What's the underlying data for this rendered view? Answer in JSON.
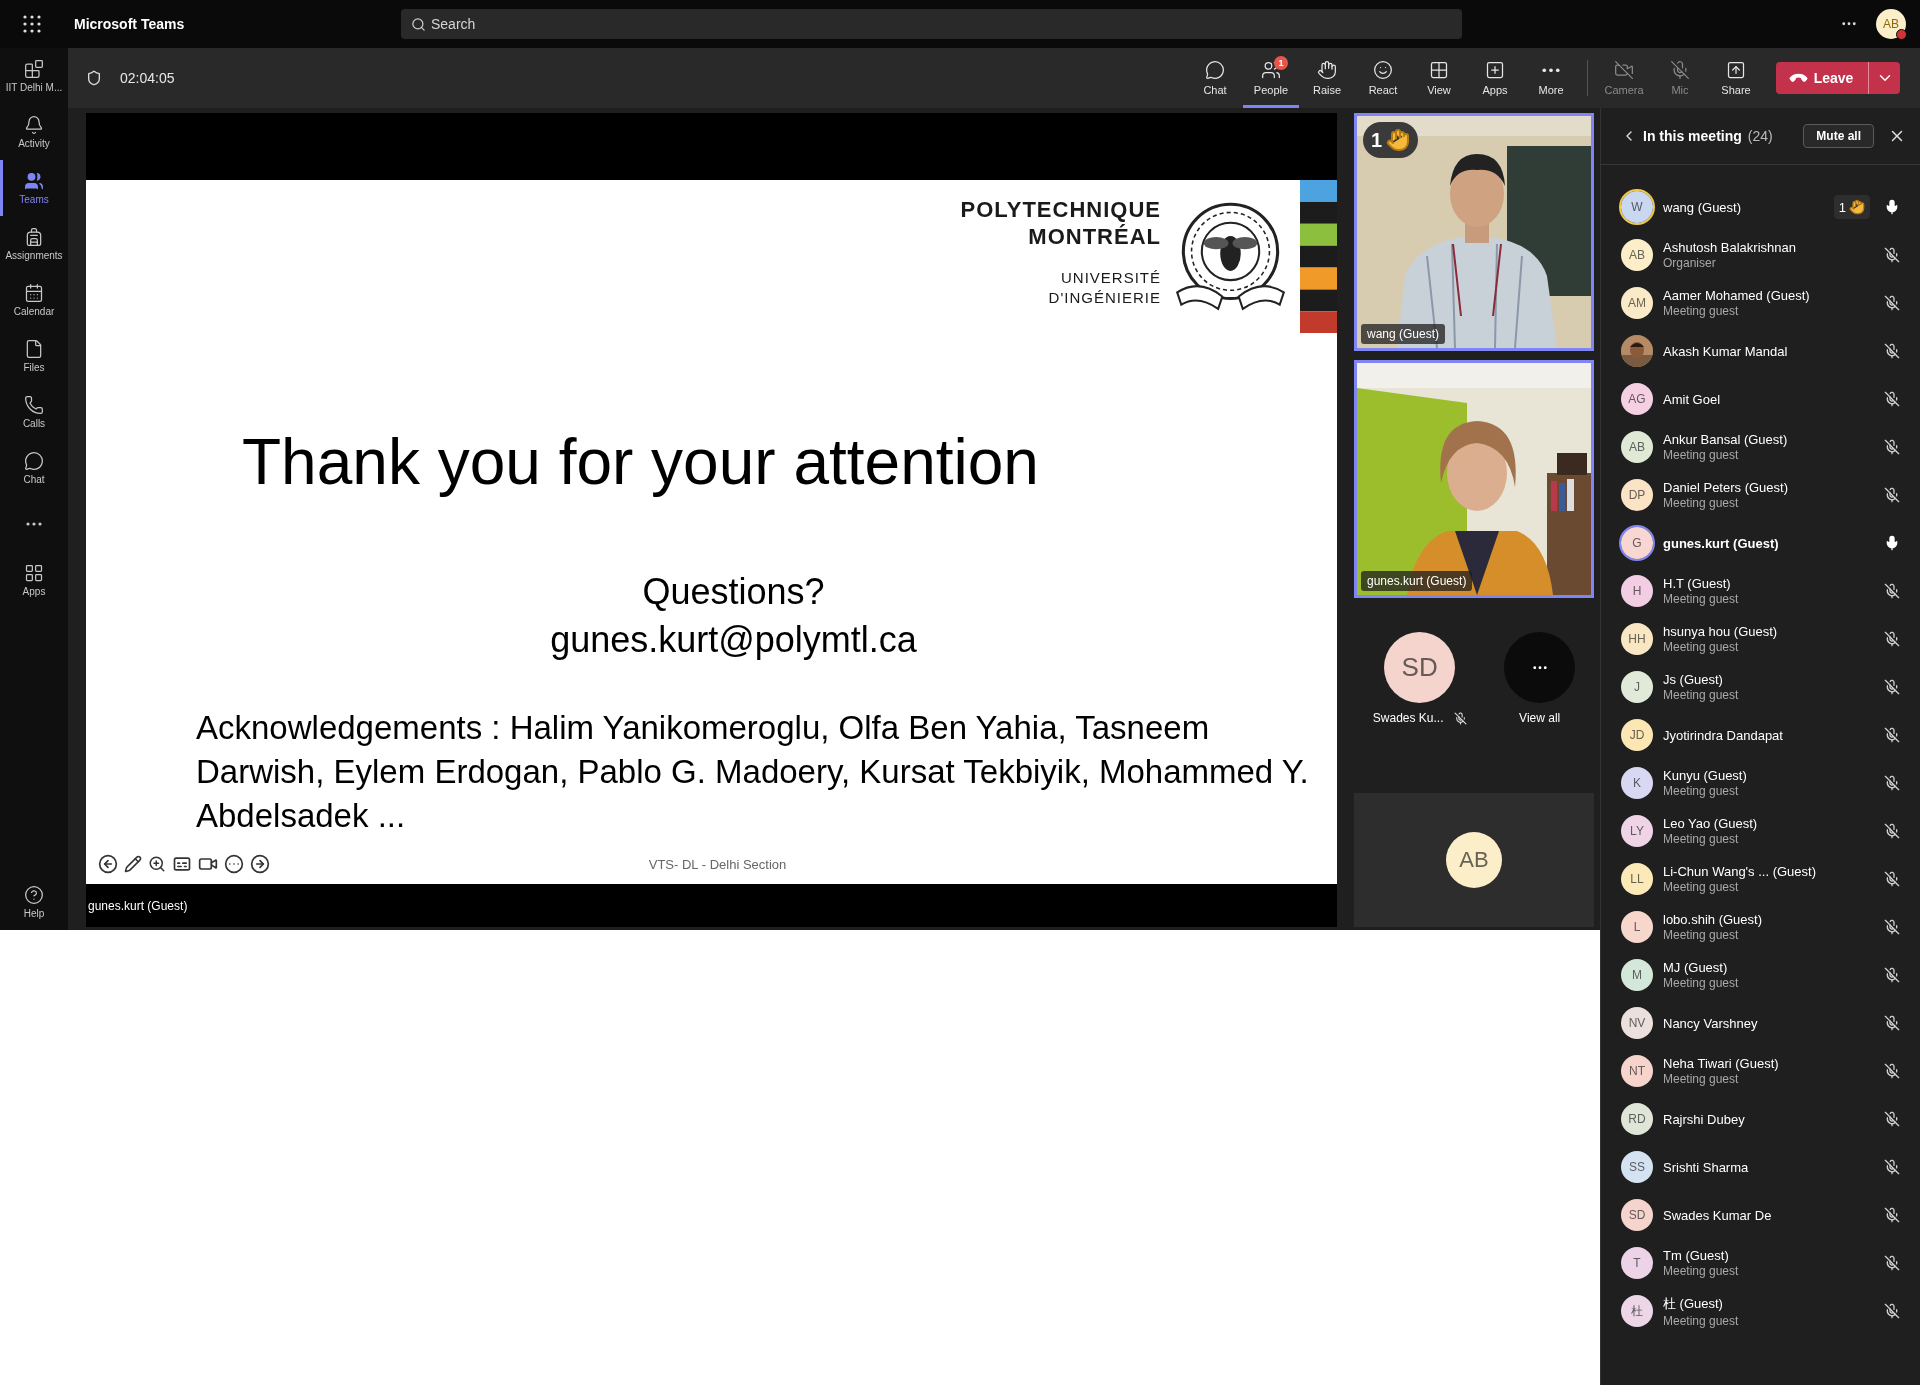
{
  "app": {
    "title": "Microsoft Teams"
  },
  "search": {
    "placeholder": "Search"
  },
  "account": {
    "initials": "AB"
  },
  "rail": {
    "items": [
      {
        "kind": "app",
        "label": "IIT Delhi M...",
        "selected": false
      },
      {
        "kind": "app",
        "label": "Activity",
        "selected": false
      },
      {
        "kind": "app",
        "label": "Teams",
        "selected": true
      },
      {
        "kind": "app",
        "label": "Assignments",
        "selected": false
      },
      {
        "kind": "app",
        "label": "Calendar",
        "selected": false
      },
      {
        "kind": "app",
        "label": "Files",
        "selected": false
      },
      {
        "kind": "app",
        "label": "Calls",
        "selected": false
      },
      {
        "kind": "app",
        "label": "Chat",
        "selected": false
      },
      {
        "kind": "more",
        "selected": false
      },
      {
        "kind": "app",
        "label": "Apps",
        "selected": false
      }
    ],
    "help": {
      "label": "Help"
    }
  },
  "meeting_toolbar": {
    "timer": "02:04:05",
    "actions": [
      {
        "label": "Chat",
        "selected": false
      },
      {
        "label": "People",
        "selected": true,
        "badge": "1"
      },
      {
        "label": "Raise",
        "selected": false
      },
      {
        "label": "React",
        "selected": false
      },
      {
        "label": "View",
        "selected": false
      },
      {
        "label": "Apps",
        "selected": false
      },
      {
        "label": "More",
        "selected": false
      }
    ],
    "devices": [
      {
        "label": "Camera",
        "off": true
      },
      {
        "label": "Mic",
        "off": true
      },
      {
        "label": "Share",
        "off": false
      }
    ],
    "leave": {
      "label": "Leave"
    }
  },
  "shared_content": {
    "slide": {
      "logo_lines": [
        "POLYTECHNIQUE",
        "MONTRÉAL"
      ],
      "logo_sub": [
        "UNIVERSITÉ",
        "D'INGÉNIERIE"
      ],
      "title": "Thank you for your attention",
      "questions": "Questions?",
      "email": "gunes.kurt@polymtl.ca",
      "acknowledgements": "Acknowledgements : Halim Yanikomeroglu, Olfa Ben Yahia, Tasneem Darwish, Eylem Erdogan, Pablo G. Madoery,  Kursat Tekbiyik, Mohammed Y. Abdelsadek  ...",
      "footer": "VTS- DL - Delhi Section"
    },
    "presenter": "gunes.kurt (Guest)"
  },
  "videos": [
    {
      "kind": "picture",
      "name": "wang (Guest)",
      "raised_hand": "1"
    },
    {
      "kind": "picture",
      "name": "gunes.kurt (Guest)"
    }
  ],
  "others": [
    {
      "kind": "avatar",
      "initials": "SD",
      "name": "Swades Ku...",
      "muted": true,
      "color": "#f4d4cc"
    },
    {
      "kind": "more",
      "label": "View all"
    }
  ],
  "self_view": {
    "initials": "AB",
    "color": "#fbeec8"
  },
  "panel": {
    "title": "In this meeting",
    "count": "(24)",
    "mute_all": "Mute all",
    "participants": [
      {
        "kind": "initials",
        "initials": "W",
        "name": "wang (Guest)",
        "color": "#c9d7f0",
        "muted": false,
        "speaking": false,
        "raised_hand": "1"
      },
      {
        "kind": "initials",
        "initials": "AB",
        "name": "Ashutosh Balakrishnan",
        "role": "Organiser",
        "color": "#fbeec8",
        "muted": true,
        "speaking": false
      },
      {
        "kind": "initials",
        "initials": "AM",
        "name": "Aamer Mohamed (Guest)",
        "role": "Meeting guest",
        "color": "#fbeac8",
        "muted": true,
        "speaking": false
      },
      {
        "name": "Akash Kumar Mandal",
        "muted": true,
        "speaking": false
      },
      {
        "kind": "initials",
        "initials": "AG",
        "name": "Amit Goel",
        "color": "#f5d0e2",
        "muted": true,
        "speaking": false
      },
      {
        "kind": "initials",
        "initials": "AB",
        "name": "Ankur Bansal (Guest)",
        "role": "Meeting guest",
        "color": "#dfe9d6",
        "muted": true,
        "speaking": false
      },
      {
        "kind": "initials",
        "initials": "DP",
        "name": "Daniel Peters (Guest)",
        "role": "Meeting guest",
        "color": "#fbe3c6",
        "muted": true,
        "speaking": false
      },
      {
        "kind": "initials",
        "initials": "G",
        "name": "gunes.kurt (Guest)",
        "color": "#f8d7d2",
        "muted": false,
        "speaking": true
      },
      {
        "kind": "initials",
        "initials": "H",
        "name": "H.T (Guest)",
        "role": "Meeting guest",
        "color": "#f3cde3",
        "muted": true,
        "speaking": false
      },
      {
        "kind": "initials",
        "initials": "HH",
        "name": "hsunya hou (Guest)",
        "role": "Meeting guest",
        "color": "#f9e6c2",
        "muted": true,
        "speaking": false
      },
      {
        "kind": "initials",
        "initials": "J",
        "name": "Js (Guest)",
        "role": "Meeting guest",
        "color": "#e1ead9",
        "muted": true,
        "speaking": false
      },
      {
        "kind": "initials",
        "initials": "JD",
        "name": "Jyotirindra Dandapat",
        "color": "#fbe6b4",
        "muted": true,
        "speaking": false
      },
      {
        "kind": "initials",
        "initials": "K",
        "name": "Kunyu (Guest)",
        "role": "Meeting guest",
        "color": "#d9d8f2",
        "muted": true,
        "speaking": false
      },
      {
        "kind": "initials",
        "initials": "LY",
        "name": "Leo Yao (Guest)",
        "role": "Meeting guest",
        "color": "#efd3e6",
        "muted": true,
        "speaking": false
      },
      {
        "kind": "initials",
        "initials": "LL",
        "name": "Li-Chun Wang's ...  (Guest)",
        "role": "Meeting guest",
        "color": "#fbeab8",
        "muted": true,
        "speaking": false
      },
      {
        "kind": "initials",
        "initials": "L",
        "name": "lobo.shih (Guest)",
        "role": "Meeting guest",
        "color": "#f7d6cc",
        "muted": true,
        "speaking": false
      },
      {
        "kind": "initials",
        "initials": "M",
        "name": "MJ (Guest)",
        "role": "Meeting guest",
        "color": "#d4e8d9",
        "muted": true,
        "speaking": false
      },
      {
        "kind": "initials",
        "initials": "NV",
        "name": "Nancy Varshney",
        "color": "#ebe0dc",
        "muted": true,
        "speaking": false
      },
      {
        "kind": "initials",
        "initials": "NT",
        "name": "Neha Tiwari (Guest)",
        "role": "Meeting guest",
        "color": "#f6d3cb",
        "muted": true,
        "speaking": false
      },
      {
        "kind": "initials",
        "initials": "RD",
        "name": "Rajrshi Dubey",
        "color": "#dfe6d7",
        "muted": true,
        "speaking": false
      },
      {
        "kind": "initials",
        "initials": "SS",
        "name": "Srishti Sharma",
        "color": "#d4e2f2",
        "muted": true,
        "speaking": false
      },
      {
        "kind": "initials",
        "initials": "SD",
        "name": "Swades Kumar De",
        "color": "#f4d4cc",
        "muted": true,
        "speaking": false
      },
      {
        "kind": "initials",
        "initials": "T",
        "name": "Tm (Guest)",
        "role": "Meeting guest",
        "color": "#ecd3e8",
        "muted": true,
        "speaking": false
      },
      {
        "kind": "initials",
        "initials": "杜",
        "name": "杜 (Guest)",
        "role": "Meeting guest",
        "color": "#ecd6e8",
        "muted": true,
        "speaking": false
      }
    ]
  }
}
